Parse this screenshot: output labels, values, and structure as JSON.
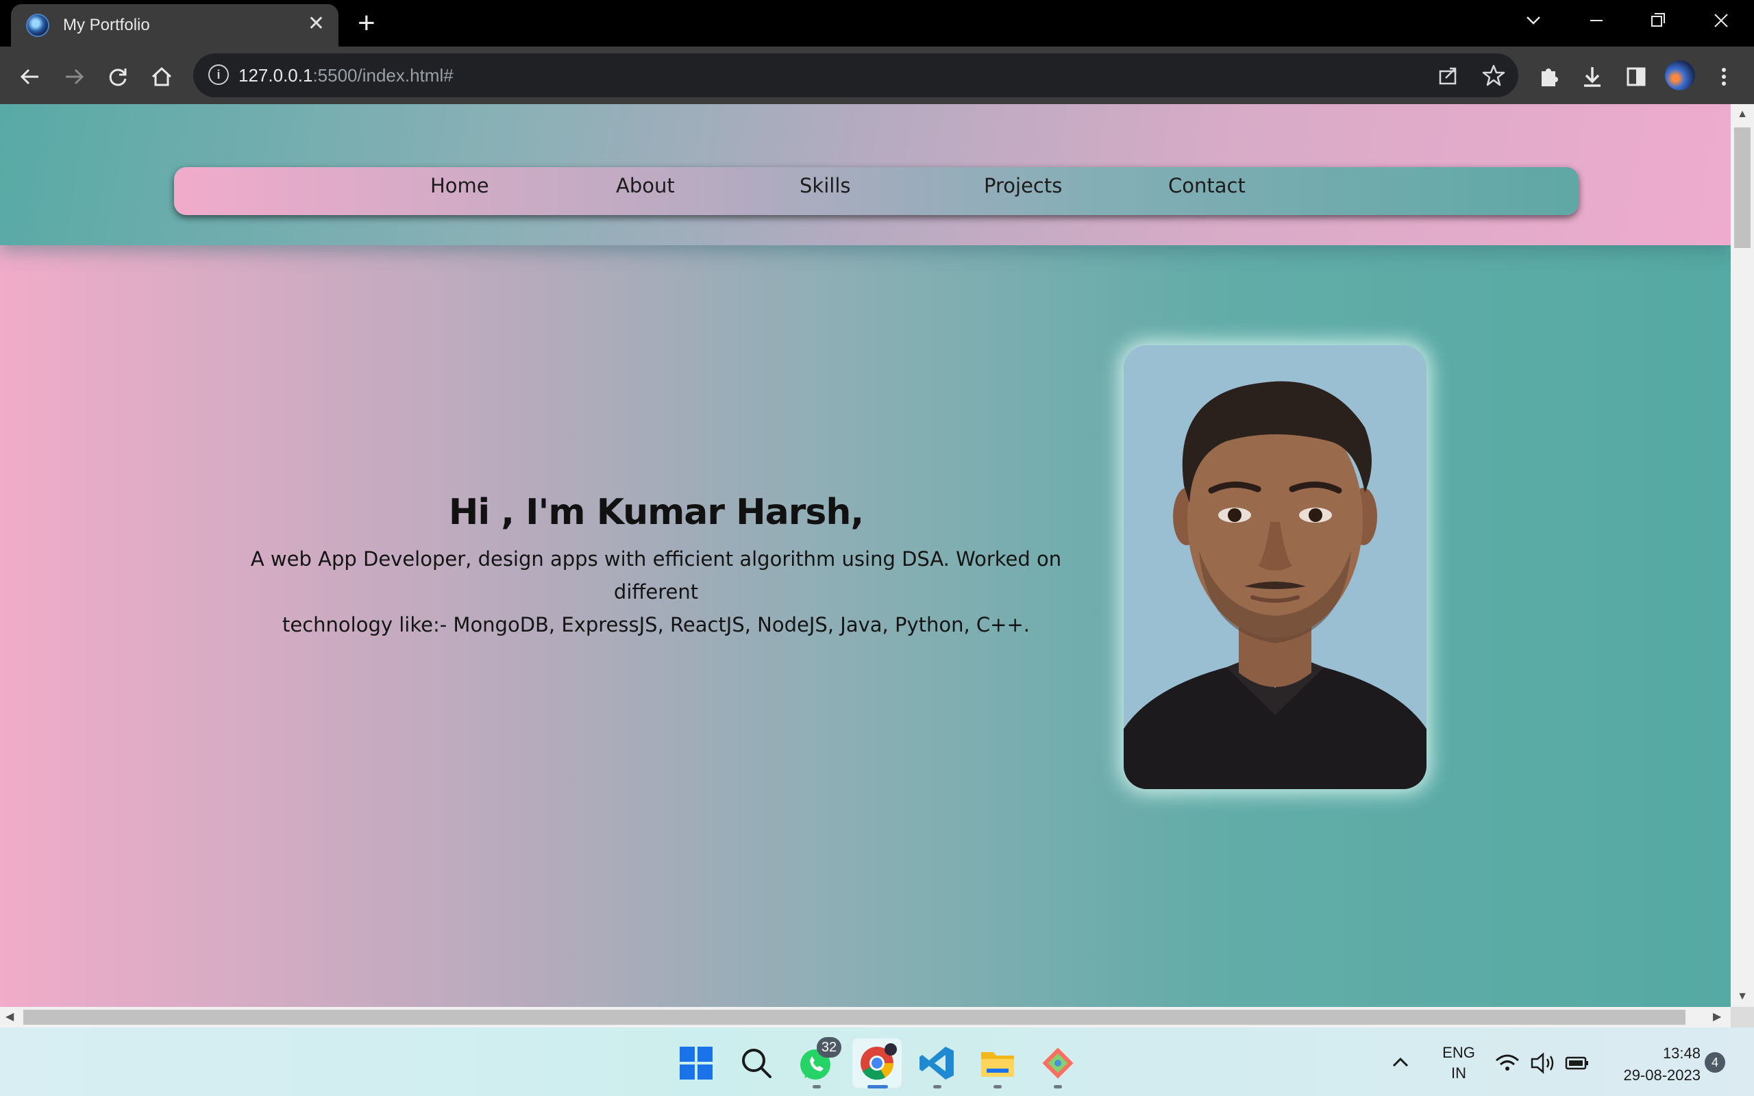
{
  "browser": {
    "tab_title": "My Portfolio",
    "url_host": "127.0.0.1",
    "url_rest": ":5500/index.html#",
    "new_tab_symbol": "+",
    "close_symbol": "✕"
  },
  "nav": {
    "items": [
      "Home",
      "About",
      "Skills",
      "Projects",
      "Contact"
    ]
  },
  "hero": {
    "title": "Hi , I'm Kumar Harsh,",
    "desc_line1": "A web App Developer, design apps with efficient algorithm using DSA. Worked on different",
    "desc_line2": "technology like:- MongoDB, ExpressJS, ReactJS, NodeJS, Java, Python, C++."
  },
  "taskbar": {
    "whatsapp_badge": "32",
    "lang_line1": "ENG",
    "lang_line2": "IN",
    "time": "13:48",
    "date": "29-08-2023",
    "notifications": "4"
  },
  "colors": {
    "pink": "#f0acc9",
    "teal": "#55aaa3"
  }
}
